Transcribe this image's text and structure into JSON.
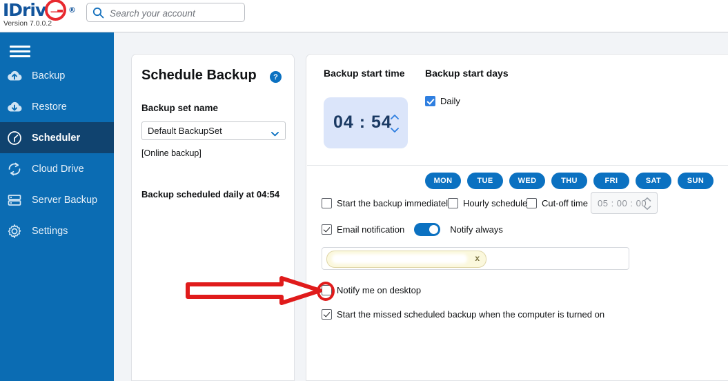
{
  "header": {
    "logo_text": "IDriv",
    "logo_letter": "e",
    "logo_registered": "®",
    "version": "Version  7.0.0.2",
    "search_placeholder": "Search your account",
    "search_value": "",
    "search_icon": "search-icon"
  },
  "sidebar": {
    "menu_icon": "hamburger-icon",
    "items": [
      {
        "label": "Backup",
        "icon": "cloud-upload-icon",
        "active": false
      },
      {
        "label": "Restore",
        "icon": "cloud-download-icon",
        "active": false
      },
      {
        "label": "Scheduler",
        "icon": "clock-icon",
        "active": true
      },
      {
        "label": "Cloud Drive",
        "icon": "sync-icon",
        "active": false
      },
      {
        "label": "Server Backup",
        "icon": "server-icon",
        "active": false
      },
      {
        "label": "Settings",
        "icon": "gear-icon",
        "active": false
      }
    ],
    "colors": {
      "bg": "#0b6cb3",
      "active_bg": "#10436f"
    }
  },
  "left_panel": {
    "title": "Schedule Backup",
    "help_badge": "?",
    "backup_set_label": "Backup set name",
    "backup_set_value": "Default BackupSet",
    "backup_set_options": [
      "Default BackupSet"
    ],
    "online_tag": "[Online backup]",
    "schedule_note": "Backup scheduled daily at 04:54"
  },
  "right_panel": {
    "start_time_title": "Backup start time",
    "start_days_title": "Backup start days",
    "time_value": "04 : 54",
    "daily_label": "Daily",
    "daily_checked": true,
    "days": [
      {
        "label": "MON",
        "selected": true
      },
      {
        "label": "TUE",
        "selected": true
      },
      {
        "label": "WED",
        "selected": true
      },
      {
        "label": "THU",
        "selected": true
      },
      {
        "label": "FRI",
        "selected": true
      },
      {
        "label": "SAT",
        "selected": true
      },
      {
        "label": "SUN",
        "selected": true
      }
    ],
    "options": {
      "start_immediately_label": "Start the backup immediately",
      "start_immediately_checked": false,
      "hourly_label": "Hourly schedule",
      "hourly_checked": false,
      "cutoff_label": "Cut-off time",
      "cutoff_checked": false,
      "cutoff_value": "05 : 00 : 00",
      "email_notification_label": "Email notification",
      "email_notification_checked": true,
      "notify_toggle_on": true,
      "notify_toggle_label": "Notify always",
      "email_chip_remove": "x",
      "notify_desktop_label": "Notify me on desktop",
      "notify_desktop_checked": false,
      "missed_backup_label": "Start the missed scheduled backup when the computer is turned on",
      "missed_backup_checked": true
    }
  },
  "annotation": {
    "arrow_color": "#e01b1b",
    "circle_target": "notify-me-on-desktop-checkbox"
  }
}
